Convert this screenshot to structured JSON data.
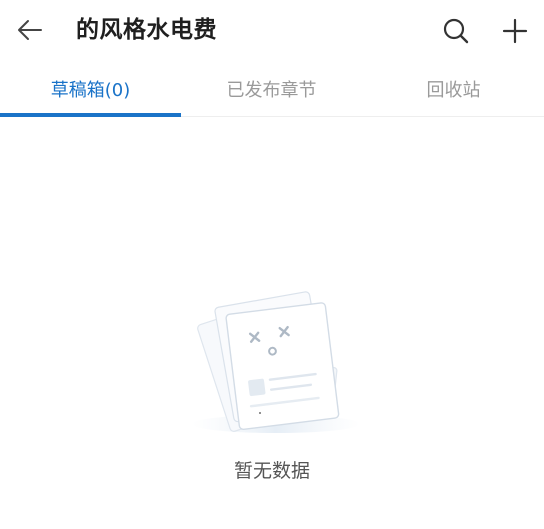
{
  "header": {
    "title": "的风格水电费",
    "back_icon": "arrow-left-icon",
    "search_icon": "search-icon",
    "add_icon": "plus-icon"
  },
  "tabs": [
    {
      "label": "草稿箱(0)",
      "active": true
    },
    {
      "label": "已发布章节",
      "active": false
    },
    {
      "label": "回收站",
      "active": false
    }
  ],
  "empty_state": {
    "icon": "empty-documents-icon",
    "text": "暂无数据"
  },
  "colors": {
    "accent": "#1a73c8",
    "title": "#1f1f1f",
    "inactive_tab": "#9a9a9a",
    "empty_text": "#555555"
  }
}
